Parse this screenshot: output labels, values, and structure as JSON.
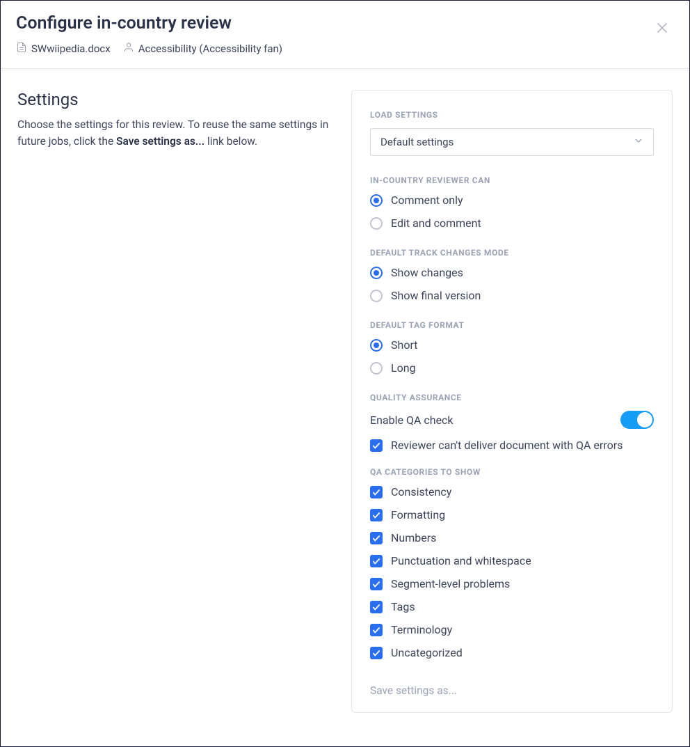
{
  "header": {
    "title": "Configure in-country review",
    "document": "SWwiipedia.docx",
    "reviewer": "Accessibility (Accessibility fan)"
  },
  "left": {
    "heading": "Settings",
    "description_pre": "Choose the settings for this review. To reuse the same settings in future jobs, click the ",
    "description_bold": "Save settings as...",
    "description_post": " link below."
  },
  "panel": {
    "load_settings": {
      "label": "LOAD SETTINGS",
      "selected": "Default settings"
    },
    "reviewer_can": {
      "label": "IN-COUNTRY REVIEWER CAN",
      "options": [
        {
          "label": "Comment only",
          "checked": true
        },
        {
          "label": "Edit and comment",
          "checked": false
        }
      ]
    },
    "track_changes": {
      "label": "DEFAULT TRACK CHANGES MODE",
      "options": [
        {
          "label": "Show changes",
          "checked": true
        },
        {
          "label": "Show final version",
          "checked": false
        }
      ]
    },
    "tag_format": {
      "label": "DEFAULT TAG FORMAT",
      "options": [
        {
          "label": "Short",
          "checked": true
        },
        {
          "label": "Long",
          "checked": false
        }
      ]
    },
    "qa": {
      "label": "QUALITY ASSURANCE",
      "enable_label": "Enable QA check",
      "enable_checked": true,
      "strict_label": "Reviewer can't deliver document with QA errors",
      "strict_checked": true
    },
    "qa_categories": {
      "label": "QA CATEGORIES TO SHOW",
      "items": [
        {
          "label": "Consistency",
          "checked": true
        },
        {
          "label": "Formatting",
          "checked": true
        },
        {
          "label": "Numbers",
          "checked": true
        },
        {
          "label": "Punctuation and whitespace",
          "checked": true
        },
        {
          "label": "Segment-level problems",
          "checked": true
        },
        {
          "label": "Tags",
          "checked": true
        },
        {
          "label": "Terminology",
          "checked": true
        },
        {
          "label": "Uncategorized",
          "checked": true
        }
      ]
    },
    "save_link": "Save settings as..."
  }
}
